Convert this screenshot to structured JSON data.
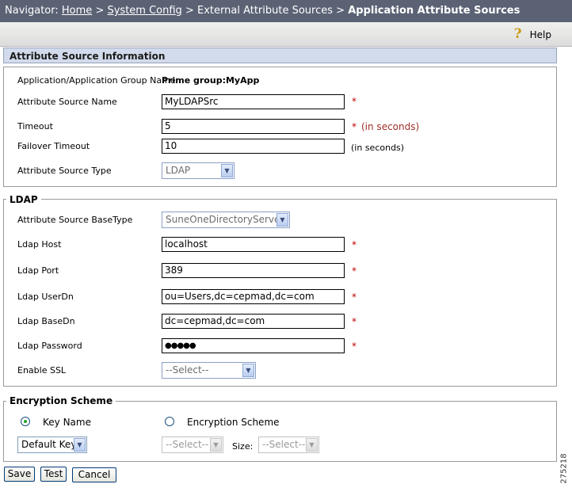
{
  "navigator": {
    "label": "Navigator:",
    "home": "Home",
    "system_config": "System Config",
    "external": "External Attribute Sources",
    "current": "Application Attribute Sources",
    "sep": ">"
  },
  "help_label": "Help",
  "attr_section": {
    "title": "Attribute Source Information",
    "app_group_label": "Application/Application Group Name",
    "app_group_value": "Prime group:MyApp",
    "name_label": "Attribute Source Name",
    "name_value": "MyLDAPSrc",
    "timeout_label": "Timeout",
    "timeout_value": "5",
    "timeout_note": "(in seconds)",
    "failover_label": "Failover Timeout",
    "failover_value": "10",
    "failover_note": "(in seconds)",
    "type_label": "Attribute Source Type",
    "type_value": "LDAP"
  },
  "ldap": {
    "legend": "LDAP",
    "basetype_label": "Attribute Source BaseType",
    "basetype_value": "SuneOneDirectoryServer",
    "host_label": "Ldap Host",
    "host_value": "localhost",
    "port_label": "Ldap Port",
    "port_value": "389",
    "userdn_label": "Ldap UserDn",
    "userdn_value": "ou=Users,dc=cepmad,dc=com",
    "basedn_label": "Ldap BaseDn",
    "basedn_value": "dc=cepmad,dc=com",
    "password_label": "Ldap Password",
    "password_value": "●●●●●",
    "ssl_label": "Enable SSL",
    "ssl_value": "--Select--"
  },
  "required_mark": "*",
  "encryption": {
    "legend": "Encryption Scheme",
    "key_name_label": "Key Name",
    "scheme_label": "Encryption Scheme",
    "key_select": "Default Key",
    "scheme_select": "--Select--",
    "size_label": "Size:",
    "size_select": "--Select--"
  },
  "buttons": {
    "save": "Save",
    "test": "Test",
    "cancel": "Cancel"
  },
  "figure_id": "275218"
}
